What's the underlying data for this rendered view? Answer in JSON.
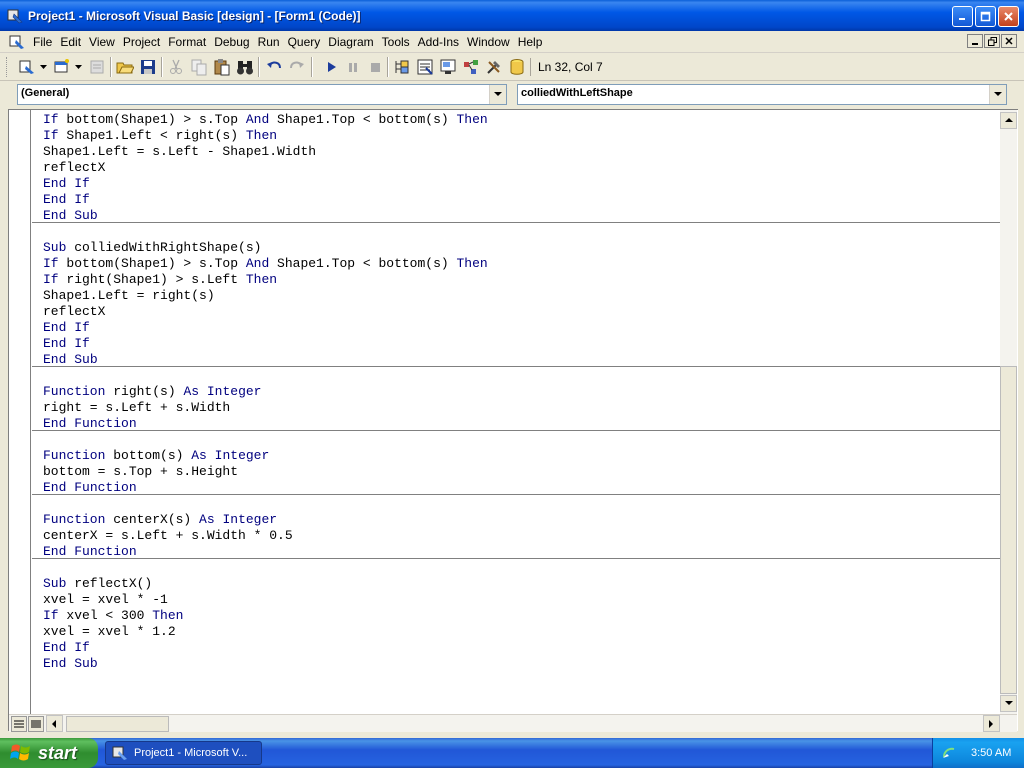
{
  "window": {
    "title": "Project1 - Microsoft Visual Basic [design] - [Form1 (Code)]"
  },
  "menu": [
    {
      "label": "File"
    },
    {
      "label": "Edit"
    },
    {
      "label": "View"
    },
    {
      "label": "Project"
    },
    {
      "label": "Format"
    },
    {
      "label": "Debug"
    },
    {
      "label": "Run"
    },
    {
      "label": "Query"
    },
    {
      "label": "Diagram"
    },
    {
      "label": "Tools"
    },
    {
      "label": "Add-Ins"
    },
    {
      "label": "Window"
    },
    {
      "label": "Help"
    }
  ],
  "toolbar": {
    "position": "Ln 32, Col 7"
  },
  "combos": {
    "object": "(General)",
    "procedure": "colliedWithLeftShape"
  },
  "code": {
    "lines": [
      "If bottom(Shape1) > s.Top And Shape1.Top < bottom(s) Then",
      "If Shape1.Left < right(s) Then",
      "Shape1.Left = s.Left - Shape1.Width",
      "reflectX",
      "End If",
      "End If",
      "End Sub",
      "Sub colliedWithRightShape(s)",
      "If bottom(Shape1) > s.Top And Shape1.Top < bottom(s) Then",
      "If right(Shape1) > s.Left Then",
      "Shape1.Left = right(s)",
      "reflectX",
      "End If",
      "End If",
      "End Sub",
      "Function right(s) As Integer",
      "right = s.Left + s.Width",
      "End Function",
      "Function bottom(s) As Integer",
      "bottom = s.Top + s.Height",
      "End Function",
      "Function centerX(s) As Integer",
      "centerX = s.Left + s.Width * 0.5",
      "End Function",
      "Sub reflectX()",
      "xvel = xvel * -1",
      "If xvel < 300 Then",
      "xvel = xvel * 1.2",
      "End If",
      "End Sub"
    ]
  },
  "taskbar": {
    "start_label": "start",
    "task_label": "Project1 - Microsoft V...",
    "clock": "3:50 AM"
  },
  "colors": {
    "keyword": "#00007F",
    "titlebar": "#0058E6",
    "taskbar": "#2157D7",
    "start": "#3C9A3C"
  }
}
